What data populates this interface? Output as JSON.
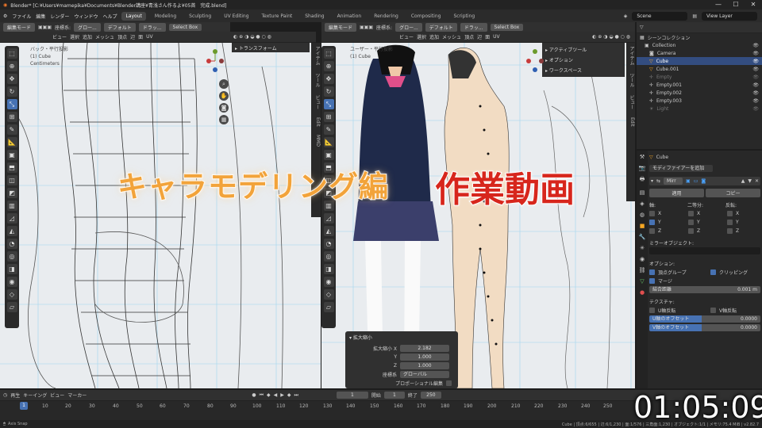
{
  "window": {
    "title": "Blender* [C:¥Users¥mamepika¥Documents¥Blender講座¥青浅さん作るよ¥05首　完成.blend]",
    "controls": [
      "—",
      "☐",
      "✕"
    ]
  },
  "menu": {
    "items": [
      "ファイル",
      "編集",
      "レンダー",
      "ウィンドウ",
      "ヘルプ"
    ],
    "workspaces": [
      "Layout",
      "Modeling",
      "Sculpting",
      "UV Editing",
      "Texture Paint",
      "Shading",
      "Animation",
      "Rendering",
      "Compositing",
      "Scripting"
    ],
    "active_workspace": "Layout",
    "scene": "Scene",
    "view_layer": "View Layer"
  },
  "left_viewport": {
    "header": {
      "mode": "編集モード",
      "orientation": "座標系:",
      "transform": "グロー...",
      "pivot": "デフォルト",
      "drag": "ドラッ...",
      "select": "Select Box",
      "menus": [
        "ビュー",
        "選択",
        "追加",
        "メッシュ",
        "頂点",
        "辺",
        "面",
        "UV"
      ]
    },
    "info": [
      "バック・平行投影",
      "(1) Cube",
      "Centimeters"
    ],
    "panel": "トランスフォーム",
    "side_tabs": [
      "アイテム",
      "ツール",
      "ビュー",
      "Edit",
      "MMD"
    ]
  },
  "right_viewport": {
    "header": {
      "mode": "編集モード",
      "orientation": "座標系:",
      "transform": "グロー...",
      "pivot": "デフォルト",
      "drag": "ドラッ...",
      "select": "Select Box",
      "menus": [
        "ビュー",
        "選択",
        "追加",
        "メッシュ",
        "頂点",
        "辺",
        "面",
        "UV"
      ]
    },
    "info": [
      "ユーザー・平行投影",
      "(1) Cube"
    ],
    "panel_items": [
      "アクティブツール",
      "オプション",
      "ワークスペース"
    ],
    "side_tabs": [
      "アイテム",
      "ツール",
      "ビュー",
      "Edit"
    ],
    "scale_panel": {
      "title": "拡大縮小",
      "x_label": "拡大縮小 X",
      "x": "2.182",
      "y_label": "Y",
      "y": "1.000",
      "z_label": "Z",
      "z": "1.000",
      "orient_label": "座標系",
      "orient": "グローバル",
      "prop_label": "プロポーショナル編集"
    }
  },
  "outliner": {
    "title": "シーンコレクション",
    "rows": [
      {
        "name": "Collection",
        "selected": false
      },
      {
        "name": "Camera",
        "selected": false
      },
      {
        "name": "Cube",
        "selected": true
      },
      {
        "name": "Cube.001",
        "selected": false
      },
      {
        "name": "Empty",
        "selected": false
      },
      {
        "name": "Empty.001",
        "selected": false
      },
      {
        "name": "Empty.002",
        "selected": false
      },
      {
        "name": "Empty.003",
        "selected": false
      },
      {
        "name": "Light",
        "selected": false
      }
    ]
  },
  "properties": {
    "object": "Cube",
    "add_modifier": "モディファイアーを追加",
    "modifier_name": "Mirr",
    "apply": "適用",
    "copy": "コピー",
    "axis_label": "軸:",
    "bisect_label": "二等分:",
    "flip_label": "反転:",
    "axes": [
      "X",
      "Y",
      "Z"
    ],
    "axis_on": [
      false,
      true,
      false
    ],
    "mirror_object_label": "ミラーオブジェクト:",
    "options_label": "オプション:",
    "vertex_groups": "頂点グループ",
    "clipping": "クリッピング",
    "merge": "マージ",
    "merge_distance_label": "結合距離",
    "merge_distance": "0.001 m",
    "texture_label": "テクスチャ:",
    "u_flip": "U軸反転",
    "v_flip": "V軸反転",
    "u_offset_label": "U軸のオフセット",
    "u_offset": "0.0000",
    "v_offset_label": "V軸のオフセット",
    "v_offset": "0.0000"
  },
  "timeline": {
    "menus": [
      "再生",
      "キーイング",
      "ビュー",
      "マーカー"
    ],
    "current_frame": "1",
    "start_label": "開始",
    "start": "1",
    "end_label": "終了",
    "end": "250",
    "ticks": [
      "1",
      "10",
      "20",
      "30",
      "40",
      "50",
      "60",
      "70",
      "80",
      "90",
      "100",
      "110",
      "120",
      "130",
      "140",
      "150",
      "160",
      "170",
      "180",
      "190",
      "200",
      "210",
      "220",
      "230",
      "240",
      "250"
    ]
  },
  "status": {
    "left": "Axis Snap",
    "right": "Cube | 頂点:6/655 | 辺:6/1,230 | 面:1/576 | 三角面:1,230 | オブジェクト:1/1 | メモリ:75.4 MiB | v2.82.7"
  },
  "overlay": {
    "title_main": "キャラモデリング編",
    "title_sub": "作業動画",
    "timer": "01:05:09"
  },
  "colors": {
    "accent": "#4772b3",
    "overlay_orange": "#f2a33a",
    "overlay_red": "#d7261c",
    "selection": "#334d80"
  }
}
